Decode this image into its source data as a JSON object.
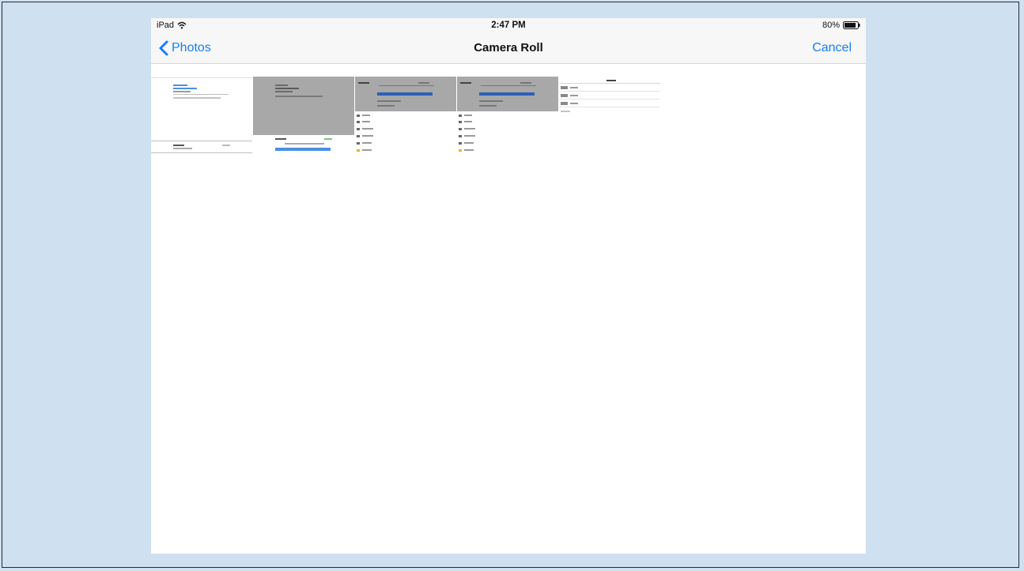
{
  "status_bar": {
    "device": "iPad",
    "time": "2:47 PM",
    "battery": "80%",
    "icons": {
      "wifi": "wifi-icon",
      "battery": "battery-icon"
    }
  },
  "nav": {
    "back_label": "Photos",
    "title": "Camera Roll",
    "cancel_label": "Cancel",
    "back_icon": "chevron-left-icon"
  },
  "photos": [
    {
      "kind": "screenshot-settings"
    },
    {
      "kind": "screenshot-settings-dimmed-sheet"
    },
    {
      "kind": "screenshot-account-dimmed"
    },
    {
      "kind": "screenshot-account-dimmed"
    },
    {
      "kind": "screenshot-photos-list"
    }
  ],
  "colors": {
    "accent": "#147efb",
    "bar_background": "#f7f7f7",
    "page_background": "#cfe0f0"
  }
}
